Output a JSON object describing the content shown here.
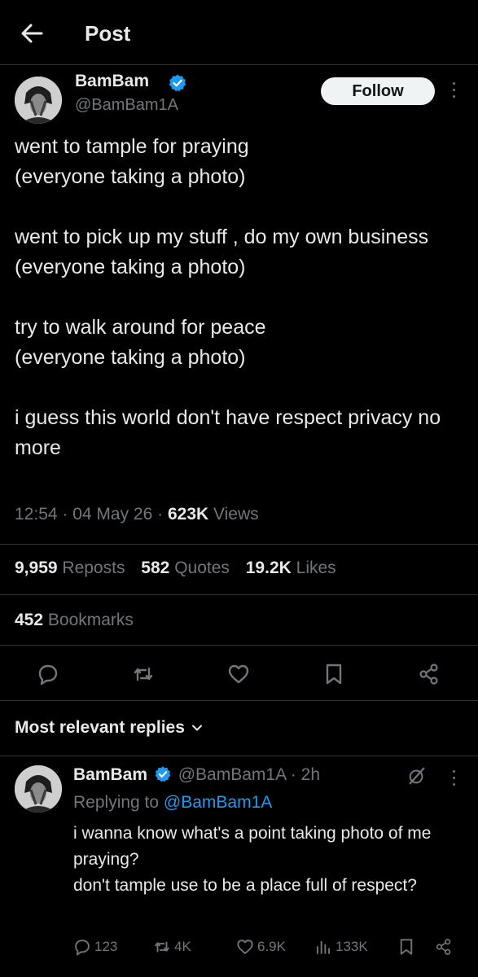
{
  "header": {
    "title": "Post",
    "back_icon": "arrow-left-icon"
  },
  "post": {
    "author_name": "BamBam",
    "author_handle": "@BamBam1A",
    "follow_label": "Follow",
    "body": "went to tample for praying\n(everyone taking a photo)\n\nwent to pick up my stuff , do my own business\n(everyone taking a photo)\n\ntry to walk around for peace\n(everyone taking a photo)\n\ni guess this world don't have respect privacy no more",
    "time": "12:54",
    "date": "04 May 26",
    "views_count": "623K",
    "views_label": "Views",
    "reposts_count": "9,959",
    "reposts_label": "Reposts",
    "quotes_count": "582",
    "quotes_label": "Quotes",
    "likes_count": "19.2K",
    "likes_label": "Likes",
    "bookmarks_count": "452",
    "bookmarks_label": "Bookmarks"
  },
  "actions": [
    "reply-icon",
    "repost-icon",
    "like-icon",
    "bookmark-icon",
    "share-icon"
  ],
  "replies_section": {
    "label": "Most relevant replies"
  },
  "reply": {
    "author_name": "BamBam",
    "author_handle": "@BamBam1A",
    "separator": "·",
    "time_ago": "2h",
    "replying_prefix": "Replying to",
    "replying_to": "@BamBam1A",
    "body": "i wanna know what's a point taking photo of me praying?\ndon't tample use to be a place full of respect?",
    "replies": "123",
    "reposts": "4K",
    "likes": "6.9K",
    "views": "133K"
  },
  "colors": {
    "background": "#000000",
    "text": "#e7e9ea",
    "muted": "#71767b",
    "accent": "#1d9bf0",
    "divider": "#2f3336"
  }
}
